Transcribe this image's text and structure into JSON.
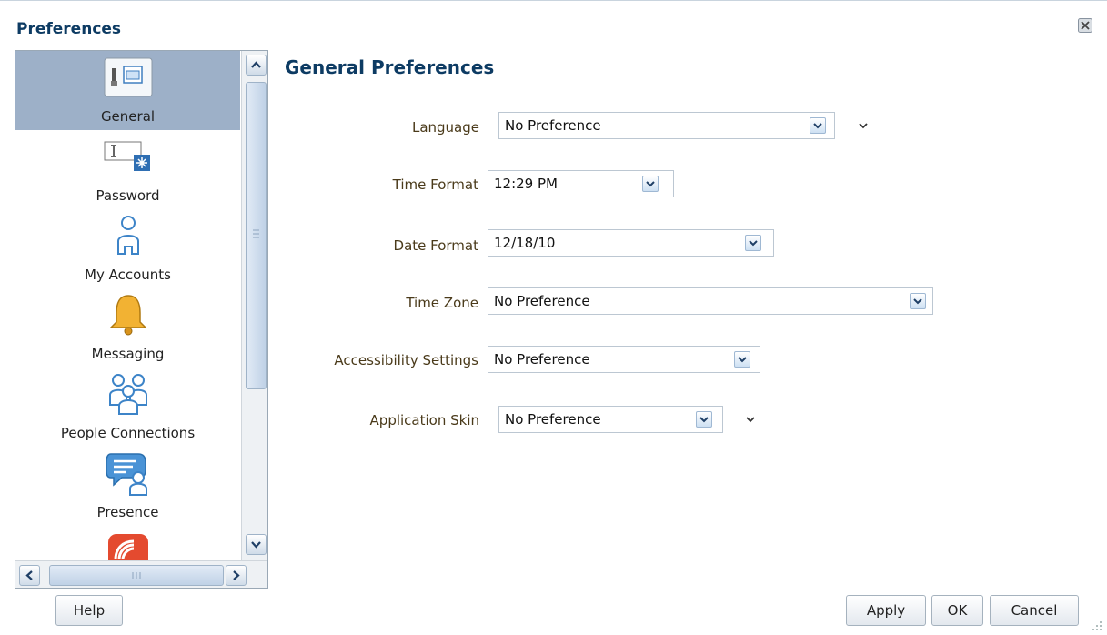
{
  "dialog": {
    "title": "Preferences"
  },
  "nav": {
    "items": [
      {
        "label": "General",
        "icon": "general-settings-icon",
        "selected": true
      },
      {
        "label": "Password",
        "icon": "password-field-icon",
        "selected": false
      },
      {
        "label": "My Accounts",
        "icon": "user-icon",
        "selected": false
      },
      {
        "label": "Messaging",
        "icon": "bell-icon",
        "selected": false
      },
      {
        "label": "People Connections",
        "icon": "people-group-icon",
        "selected": false
      },
      {
        "label": "Presence",
        "icon": "presence-chat-icon",
        "selected": false
      },
      {
        "label": "",
        "icon": "feed-icon",
        "selected": false
      }
    ]
  },
  "main": {
    "title": "General Preferences",
    "fields": [
      {
        "label": "Language",
        "value": "No Preference"
      },
      {
        "label": "Time Format",
        "value": "12:29 PM"
      },
      {
        "label": "Date Format",
        "value": "12/18/10"
      },
      {
        "label": "Time Zone",
        "value": "No Preference"
      },
      {
        "label": "Accessibility Settings",
        "value": "No Preference"
      },
      {
        "label": "Application Skin",
        "value": "No Preference"
      }
    ]
  },
  "buttons": {
    "help": "Help",
    "apply": "Apply",
    "ok": "OK",
    "cancel": "Cancel"
  },
  "colors": {
    "title": "#0d3b63",
    "selected_nav": "#9db0c8",
    "label_text": "#4a3a1a"
  }
}
